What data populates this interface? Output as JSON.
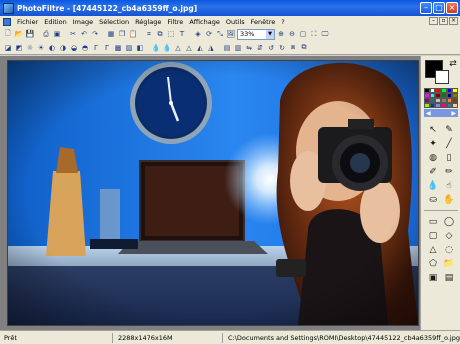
{
  "window": {
    "title": "PhotoFiltre - [47445122_cb4a6359ff_o.jpg]"
  },
  "menu": [
    "Fichier",
    "Edition",
    "Image",
    "Sélection",
    "Réglage",
    "Filtre",
    "Affichage",
    "Outils",
    "Fenêtre",
    "?"
  ],
  "toolbar": {
    "zoom_value": "33%"
  },
  "palette": {
    "colors": [
      "#000000",
      "#ffffff",
      "#ff0000",
      "#00ff00",
      "#0000ff",
      "#ffff00",
      "#ff00ff",
      "#00ffff",
      "#800000",
      "#008000",
      "#000080",
      "#808000",
      "#800080",
      "#008080",
      "#c0c0c0",
      "#808080",
      "#ff8040",
      "#804000",
      "#80ff00",
      "#004080",
      "#8080ff",
      "#ff0080",
      "#408080",
      "#ffcc99"
    ]
  },
  "status": {
    "state": "Prêt",
    "size": "2288x1476x16M",
    "path": "C:\\Documents and Settings\\ROMI\\Desktop\\47445122_cb4a6359ff_o.jpg"
  }
}
